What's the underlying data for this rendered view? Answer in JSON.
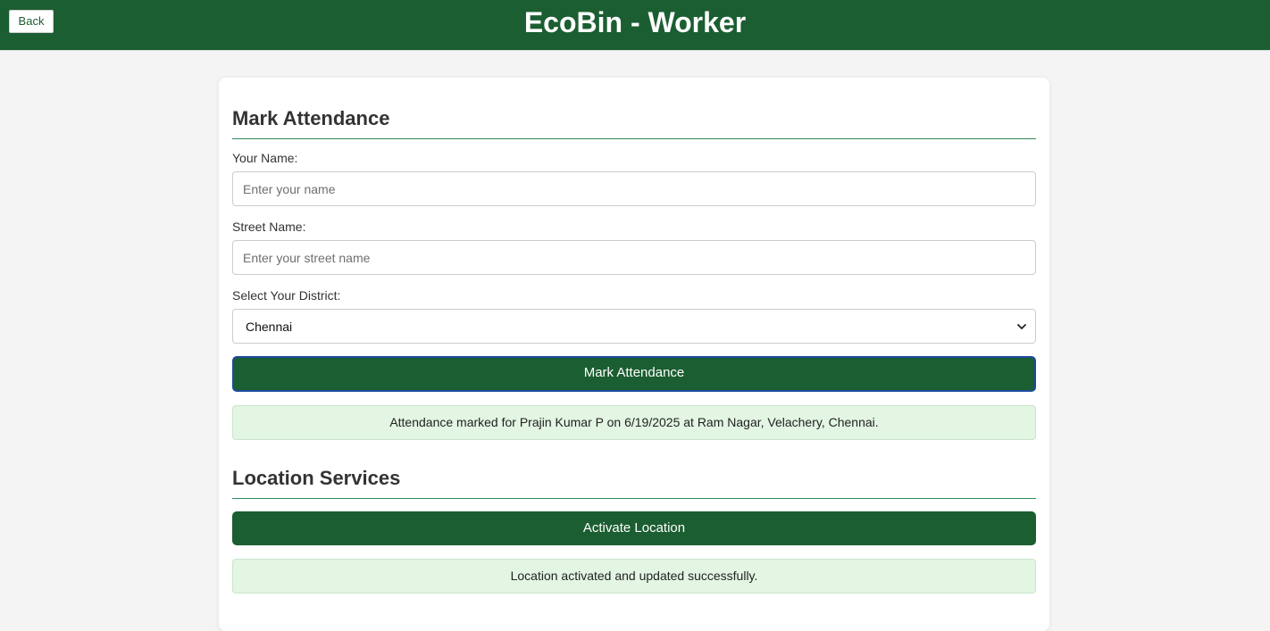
{
  "header": {
    "back_label": "Back",
    "title": "EcoBin - Worker",
    "background_color": "#1b5e31"
  },
  "attendance": {
    "title": "Mark Attendance",
    "name_label": "Your Name:",
    "name_placeholder": "Enter your name",
    "name_value": "",
    "street_label": "Street Name:",
    "street_placeholder": "Enter your street name",
    "street_value": "",
    "district_label": "Select Your District:",
    "district_value": "Chennai",
    "submit_label": "Mark Attendance",
    "status_message": "Attendance marked for Prajin Kumar P on 6/19/2025 at Ram Nagar, Velachery, Chennai."
  },
  "location": {
    "title": "Location Services",
    "activate_label": "Activate Location",
    "status_message": "Location activated and updated successfully."
  },
  "icons": {
    "district_dropdown": "chevron-down-icon"
  },
  "colors": {
    "brand_green": "#1b5e31",
    "success_background": "#e3f5e3",
    "page_background": "#f4f4f4"
  }
}
